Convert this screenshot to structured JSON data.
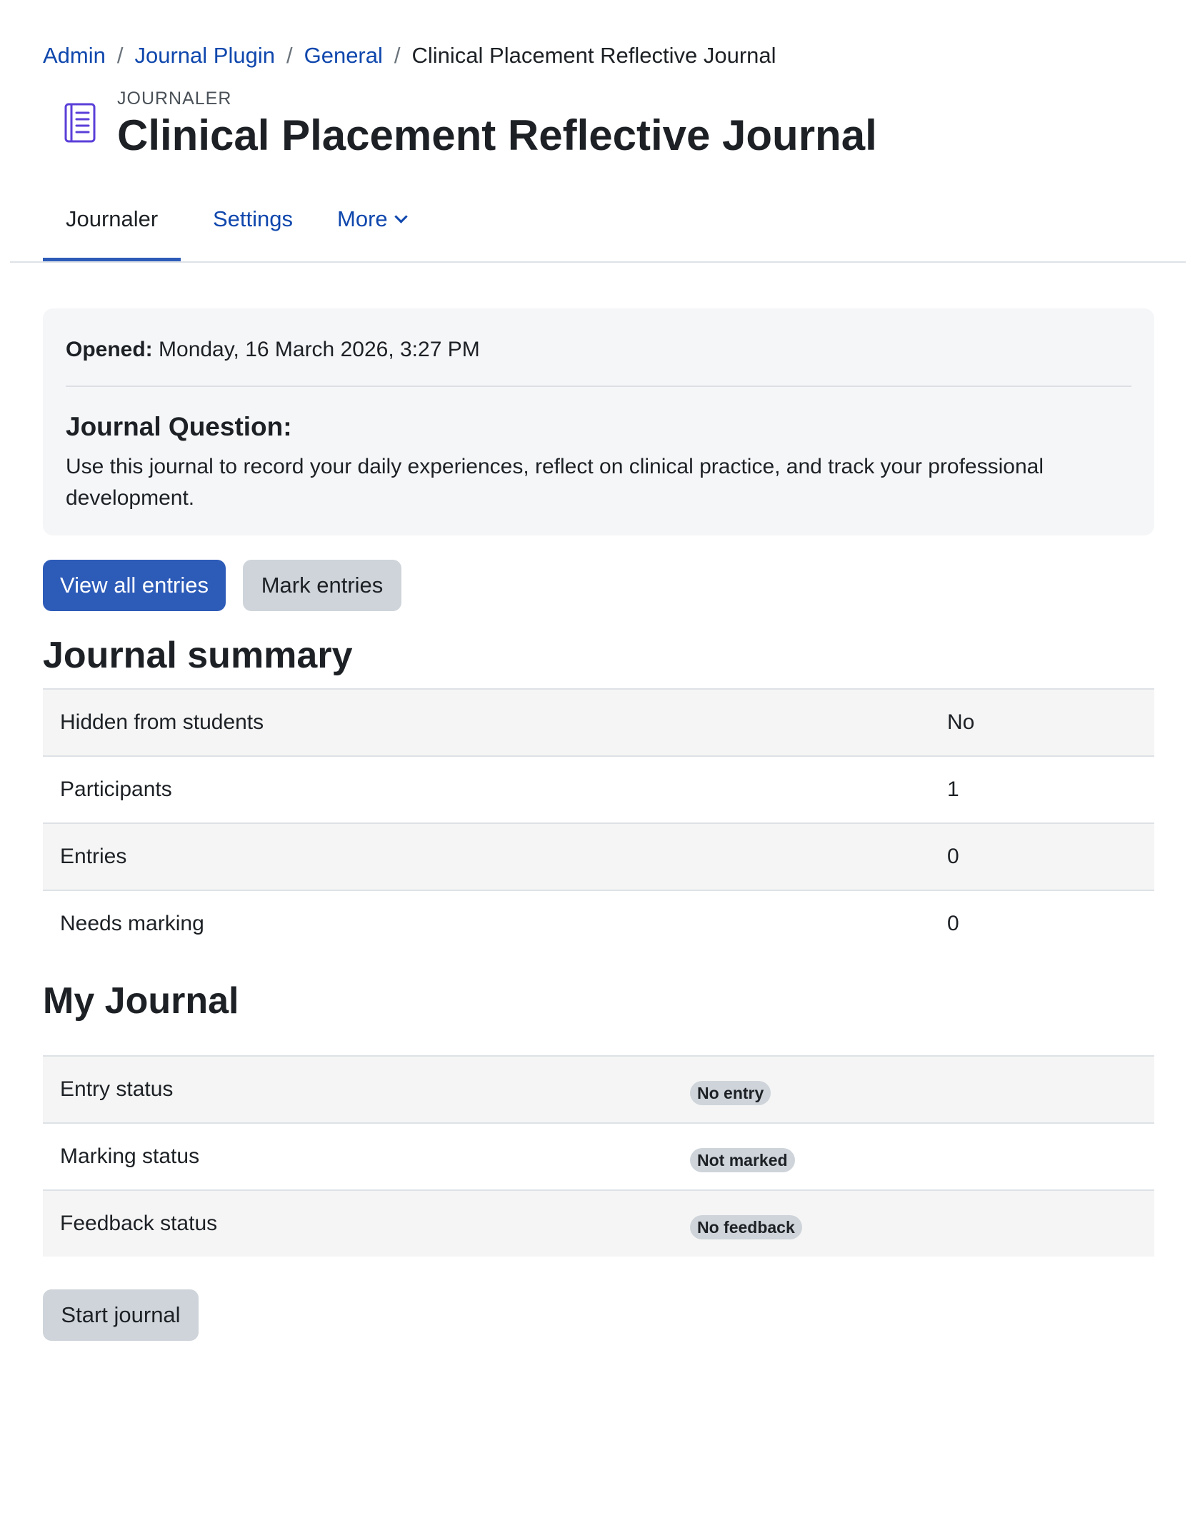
{
  "breadcrumb": {
    "items": [
      "Admin",
      "Journal Plugin",
      "General"
    ],
    "current": "Clinical Placement Reflective Journal",
    "separator": "/"
  },
  "header": {
    "module_name": "JOURNALER",
    "title": "Clinical Placement Reflective Journal",
    "icon": "journal-icon",
    "icon_color": "#5b3fd9"
  },
  "tabs": {
    "active": "Journaler",
    "settings": "Settings",
    "more": "More"
  },
  "info": {
    "opened_label": "Opened:",
    "opened_value": "Monday, 16 March 2026, 3:27 PM",
    "question_heading": "Journal Question:",
    "question_text": "Use this journal to record your daily experiences, reflect on clinical practice, and track your professional development."
  },
  "actions": {
    "view_all": "View all entries",
    "mark": "Mark entries",
    "start": "Start journal"
  },
  "summary": {
    "heading": "Journal summary",
    "rows": [
      {
        "label": "Hidden from students",
        "value": "No"
      },
      {
        "label": "Participants",
        "value": "1"
      },
      {
        "label": "Entries",
        "value": "0"
      },
      {
        "label": "Needs marking",
        "value": "0"
      }
    ]
  },
  "my_journal": {
    "heading": "My Journal",
    "rows": [
      {
        "label": "Entry status",
        "badge": "No entry"
      },
      {
        "label": "Marking status",
        "badge": "Not marked"
      },
      {
        "label": "Feedback status",
        "badge": "No feedback"
      }
    ]
  },
  "colors": {
    "accent": "#2d5bb8",
    "link": "#0f47ad",
    "badge_bg": "#ced4da",
    "panel_bg": "#f5f6f8"
  }
}
